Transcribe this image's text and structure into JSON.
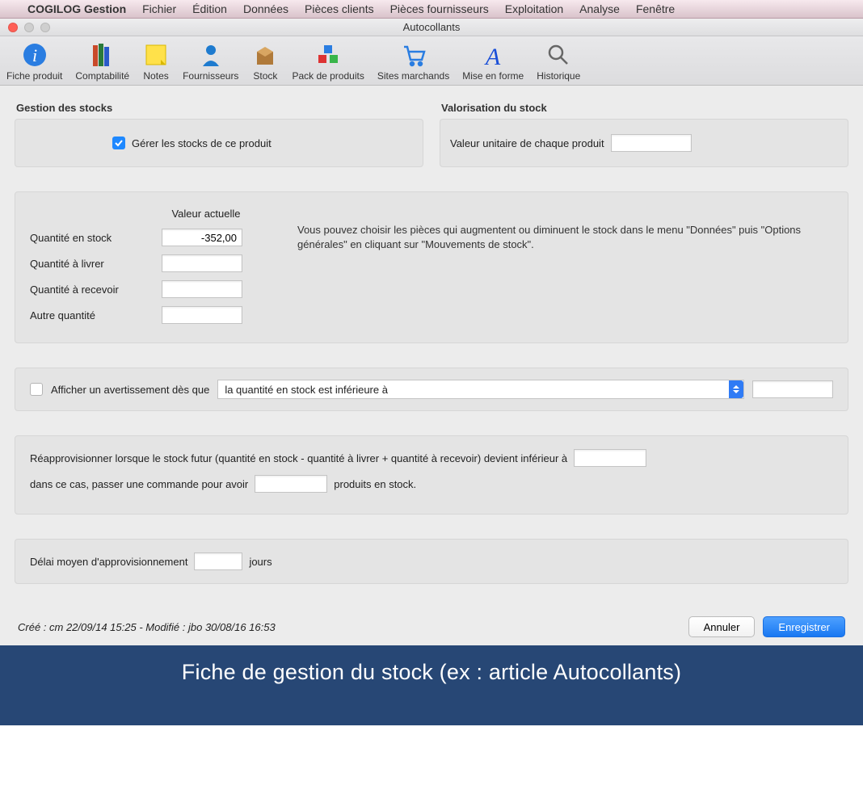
{
  "menubar": {
    "app_name": "COGILOG Gestion",
    "items": [
      "Fichier",
      "Édition",
      "Données",
      "Pièces clients",
      "Pièces fournisseurs",
      "Exploitation",
      "Analyse",
      "Fenêtre"
    ]
  },
  "window": {
    "title": "Autocollants"
  },
  "toolbar": {
    "items": [
      {
        "icon": "info-icon",
        "label": "Fiche produit"
      },
      {
        "icon": "books-icon",
        "label": "Comptabilité"
      },
      {
        "icon": "note-icon",
        "label": "Notes"
      },
      {
        "icon": "person-icon",
        "label": "Fournisseurs"
      },
      {
        "icon": "box-icon",
        "label": "Stock"
      },
      {
        "icon": "cubes-icon",
        "label": "Pack de produits"
      },
      {
        "icon": "cart-icon",
        "label": "Sites marchands"
      },
      {
        "icon": "font-icon",
        "label": "Mise en forme"
      },
      {
        "icon": "magnifier-icon",
        "label": "Historique"
      }
    ]
  },
  "sections": {
    "stock_mgmt_title": "Gestion des stocks",
    "manage_label": "Gérer les stocks de ce produit",
    "valuation_title": "Valorisation du stock",
    "unit_value_label": "Valeur unitaire de chaque produit",
    "unit_value": "",
    "current_value_header": "Valeur actuelle",
    "qty_stock_label": "Quantité en stock",
    "qty_stock_value": "-352,00",
    "qty_deliver_label": "Quantité à livrer",
    "qty_deliver_value": "",
    "qty_receive_label": "Quantité à recevoir",
    "qty_receive_value": "",
    "qty_other_label": "Autre quantité",
    "qty_other_value": "",
    "hint_text": "Vous pouvez choisir les pièces qui augmentent ou diminuent le stock dans le menu \"Données\" puis \"Options générales\" en cliquant sur \"Mouvements de stock\".",
    "warn_checkbox_label": "Afficher un avertissement dès que",
    "warn_select_value": "la quantité en stock est inférieure à",
    "warn_threshold": "",
    "reappro_text_1": "Réapprovisionner lorsque le stock futur (quantité en stock - quantité à livrer + quantité à recevoir) devient inférieur à",
    "reappro_threshold": "",
    "reappro_text_2a": "dans ce cas, passer une commande pour avoir",
    "reappro_order_qty": "",
    "reappro_text_2b": "produits en stock.",
    "delay_label": "Délai moyen d'approvisionnement",
    "delay_value": "",
    "delay_unit": "jours",
    "created_modified": "Créé : cm 22/09/14 15:25 - Modifié : jbo 30/08/16 16:53",
    "cancel_label": "Annuler",
    "save_label": "Enregistrer"
  },
  "caption": "Fiche de gestion du stock (ex : article Autocollants)"
}
